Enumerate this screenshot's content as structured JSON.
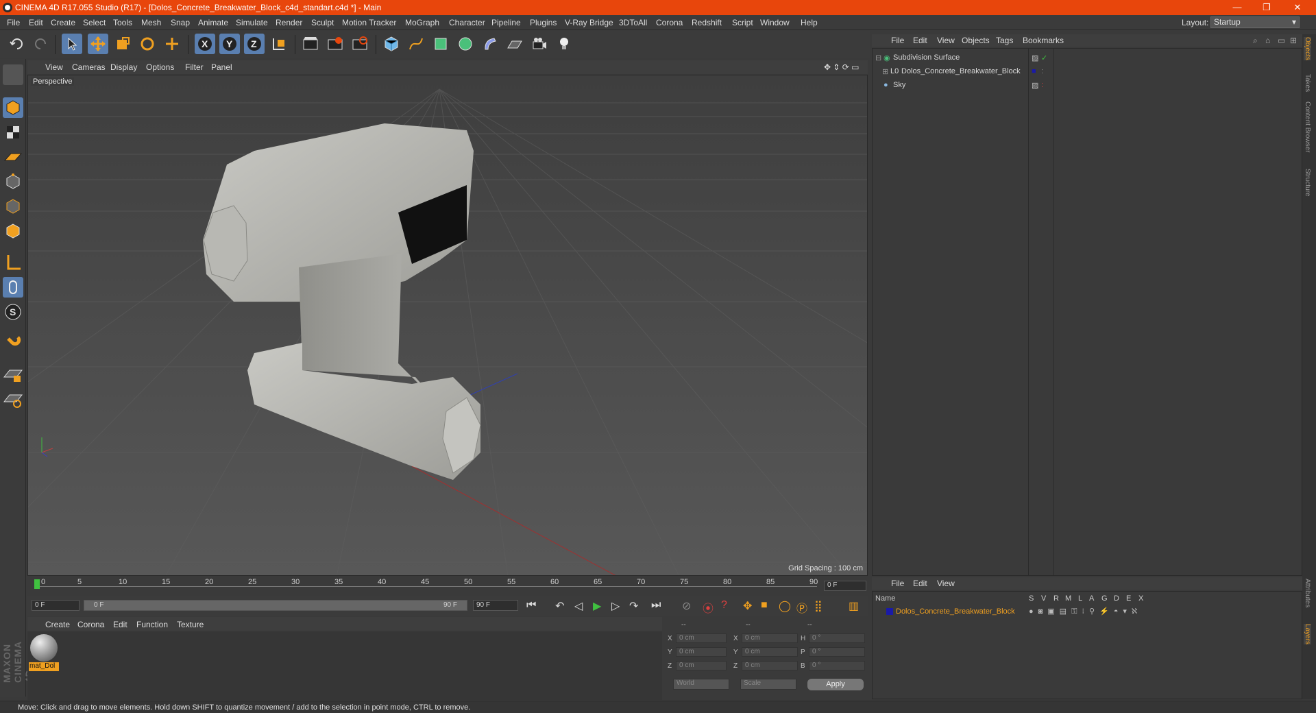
{
  "title": "CINEMA 4D R17.055 Studio (R17) - [Dolos_Concrete_Breakwater_Block_c4d_standart.c4d *] - Main",
  "window_controls": {
    "minimize": "—",
    "restore": "❐",
    "close": "✕"
  },
  "menu": [
    "File",
    "Edit",
    "Create",
    "Select",
    "Tools",
    "Mesh",
    "Snap",
    "Animate",
    "Simulate",
    "Render",
    "Sculpt",
    "Motion Tracker",
    "MoGraph",
    "Character",
    "Pipeline",
    "Plugins",
    "V-Ray Bridge",
    "3DToAll",
    "Corona",
    "Redshift",
    "Script",
    "Window",
    "Help"
  ],
  "layout": {
    "label": "Layout:",
    "value": "Startup"
  },
  "toolbar_icons": [
    "undo-icon",
    "redo-icon",
    "select-arrow-icon",
    "move-icon",
    "scale-icon",
    "rotate-icon",
    "move-axis-icon",
    "x-axis-icon",
    "y-axis-icon",
    "z-axis-icon",
    "coordinate-system-icon",
    "render-view-icon",
    "render-picture-viewer-icon",
    "render-settings-icon",
    "cube-icon",
    "pen-spline-icon",
    "subdivision-icon",
    "array-icon",
    "deformer-icon",
    "floor-icon",
    "camera-icon",
    "light-icon"
  ],
  "left_icons": [
    "make-editable-icon",
    "model-mode-icon",
    "texture-mode-icon",
    "workplane-icon",
    "points-mode-icon",
    "edges-mode-icon",
    "polygons-mode-icon",
    "axis-icon",
    "tweak-icon",
    "sculpt-s-icon",
    "snap-magnet-icon",
    "lock-workplane-icon",
    "solo-icon"
  ],
  "viewport": {
    "menu": [
      "View",
      "Cameras",
      "Display",
      "Options",
      "Filter",
      "Panel"
    ],
    "label": "Perspective",
    "grid_spacing": "Grid Spacing : 100 cm"
  },
  "timeline": {
    "ticks": [
      "0",
      "5",
      "10",
      "15",
      "20",
      "25",
      "30",
      "35",
      "40",
      "45",
      "50",
      "55",
      "60",
      "65",
      "70",
      "75",
      "80",
      "85",
      "90"
    ],
    "current_frame": "0 F",
    "start_frame": "0 F",
    "range_start": "0 F",
    "range_end": "90 F",
    "end_frame": "90 F"
  },
  "material_manager": {
    "menu": [
      "Create",
      "Corona",
      "Edit",
      "Function",
      "Texture"
    ],
    "materials": [
      {
        "name": "mat_Dol"
      }
    ]
  },
  "coordinates": {
    "headers": [
      "--",
      "--",
      "--"
    ],
    "rows": [
      {
        "a": "X",
        "av": "0 cm",
        "b": "X",
        "bv": "0 cm",
        "c": "H",
        "cv": "0 °"
      },
      {
        "a": "Y",
        "av": "0 cm",
        "b": "Y",
        "bv": "0 cm",
        "c": "P",
        "cv": "0 °"
      },
      {
        "a": "Z",
        "av": "0 cm",
        "b": "Z",
        "bv": "0 cm",
        "c": "B",
        "cv": "0 °"
      }
    ],
    "world": "World",
    "scale": "Scale",
    "apply": "Apply"
  },
  "object_manager": {
    "menu": [
      "File",
      "Edit",
      "View",
      "Objects",
      "Tags",
      "Bookmarks"
    ],
    "objects": [
      {
        "name": "Subdivision Surface",
        "indent": 0
      },
      {
        "name": "Dolos_Concrete_Breakwater_Block",
        "indent": 1
      },
      {
        "name": "Sky",
        "indent": 0
      }
    ]
  },
  "layer_manager": {
    "menu": [
      "File",
      "Edit",
      "View"
    ],
    "columns": [
      "Name",
      "S",
      "V",
      "R",
      "M",
      "L",
      "A",
      "G",
      "D",
      "E",
      "X"
    ],
    "layers": [
      {
        "name": "Dolos_Concrete_Breakwater_Block",
        "color": "#1a1aa8"
      }
    ]
  },
  "right_tabs": [
    "Objects",
    "Takes",
    "Content Browser",
    "Structure",
    "Attributes",
    "Layers"
  ],
  "brand": "MAXON CINEMA 4D",
  "status": "Move: Click and drag to move elements. Hold down SHIFT to quantize movement / add to the selection in point mode, CTRL to remove.",
  "colors": {
    "title_bar": "#e8460c",
    "accent_orange": "#f0a020",
    "panel": "#3a3a3a"
  }
}
